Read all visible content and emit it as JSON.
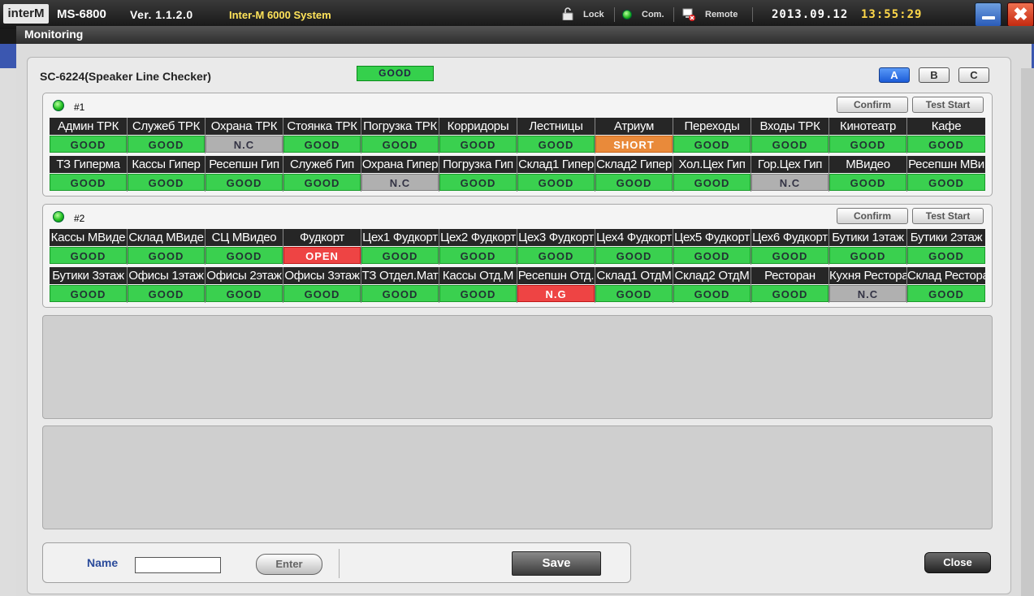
{
  "titlebar": {
    "logo": "interM",
    "model": "MS-6800",
    "version": "Ver. 1.1.2.0",
    "system": "Inter-M 6000 System",
    "lock_label": "Lock",
    "com_label": "Com.",
    "remote_label": "Remote",
    "date": "2013.09.12",
    "time": "13:55:29",
    "close_glyph": "✖"
  },
  "window": {
    "title": "Monitoring"
  },
  "checker": {
    "title": "SC-6224(Speaker Line Checker)",
    "overall_status": "GOOD",
    "pages": [
      "A",
      "B",
      "C"
    ],
    "active_page": "A"
  },
  "groups": [
    {
      "label": "#1",
      "confirm_label": "Confirm",
      "test_label": "Test Start",
      "rows": [
        [
          {
            "name": "Админ ТРК",
            "status": "GOOD"
          },
          {
            "name": "Служеб ТРК",
            "status": "GOOD"
          },
          {
            "name": "Охрана ТРК",
            "status": "N.C"
          },
          {
            "name": "Стоянка ТРК",
            "status": "GOOD"
          },
          {
            "name": "Погрузка ТРК",
            "status": "GOOD"
          },
          {
            "name": "Корридоры",
            "status": "GOOD"
          },
          {
            "name": "Лестницы",
            "status": "GOOD"
          },
          {
            "name": "Атриум",
            "status": "SHORT"
          },
          {
            "name": "Переходы",
            "status": "GOOD"
          },
          {
            "name": "Входы ТРК",
            "status": "GOOD"
          },
          {
            "name": "Кинотеатр",
            "status": "GOOD"
          },
          {
            "name": "Кафе",
            "status": "GOOD"
          }
        ],
        [
          {
            "name": "ТЗ Гиперма",
            "status": "GOOD"
          },
          {
            "name": "Кассы Гипер",
            "status": "GOOD"
          },
          {
            "name": "Ресепшн Гип",
            "status": "GOOD"
          },
          {
            "name": "Служеб Гип",
            "status": "GOOD"
          },
          {
            "name": "Охрана Гипер",
            "status": "N.C"
          },
          {
            "name": "Погрузка Гип",
            "status": "GOOD"
          },
          {
            "name": "Склад1 Гипер",
            "status": "GOOD"
          },
          {
            "name": "Склад2 Гипер",
            "status": "GOOD"
          },
          {
            "name": "Хол.Цех Гип",
            "status": "GOOD"
          },
          {
            "name": "Гор.Цех Гип",
            "status": "N.C"
          },
          {
            "name": "МВидео",
            "status": "GOOD"
          },
          {
            "name": "Ресепшн МВи",
            "status": "GOOD"
          }
        ]
      ]
    },
    {
      "label": "#2",
      "confirm_label": "Confirm",
      "test_label": "Test Start",
      "rows": [
        [
          {
            "name": "Кассы МВиде",
            "status": "GOOD"
          },
          {
            "name": "Склад МВиде",
            "status": "GOOD"
          },
          {
            "name": "СЦ МВидео",
            "status": "GOOD"
          },
          {
            "name": "Фудкорт",
            "status": "OPEN"
          },
          {
            "name": "Цех1 Фудкорт",
            "status": "GOOD"
          },
          {
            "name": "Цех2 Фудкорт",
            "status": "GOOD"
          },
          {
            "name": "Цех3 Фудкорт",
            "status": "GOOD"
          },
          {
            "name": "Цех4 Фудкорт",
            "status": "GOOD"
          },
          {
            "name": "Цех5 Фудкорт",
            "status": "GOOD"
          },
          {
            "name": "Цех6 Фудкорт",
            "status": "GOOD"
          },
          {
            "name": "Бутики 1этаж",
            "status": "GOOD"
          },
          {
            "name": "Бутики 2этаж",
            "status": "GOOD"
          }
        ],
        [
          {
            "name": "Бутики 3этаж",
            "status": "GOOD"
          },
          {
            "name": "Офисы 1этаж",
            "status": "GOOD"
          },
          {
            "name": "Офисы 2этаж",
            "status": "GOOD"
          },
          {
            "name": "Офисы 3этаж",
            "status": "GOOD"
          },
          {
            "name": "ТЗ Отдел.Мат",
            "status": "GOOD"
          },
          {
            "name": "Кассы Отд.М",
            "status": "GOOD"
          },
          {
            "name": "Ресепшн Отд.",
            "status": "N.G"
          },
          {
            "name": "Склад1 ОтдМ",
            "status": "GOOD"
          },
          {
            "name": "Склад2 ОтдМ",
            "status": "GOOD"
          },
          {
            "name": "Ресторан",
            "status": "GOOD"
          },
          {
            "name": "Кухня Ресторан",
            "status": "N.C"
          },
          {
            "name": "Склад Ресторан",
            "status": "GOOD"
          }
        ]
      ]
    }
  ],
  "footer": {
    "name_label": "Name",
    "name_value": "",
    "enter_label": "Enter",
    "save_label": "Save",
    "close_label": "Close"
  }
}
